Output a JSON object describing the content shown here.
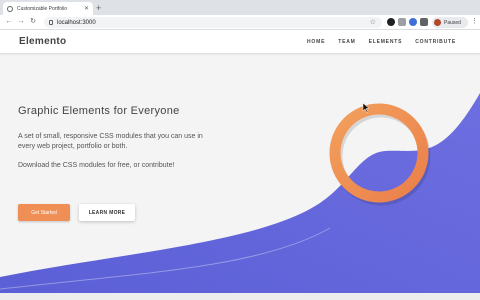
{
  "browser": {
    "tab_title": "Customizable Portfolio",
    "url": "localhost:3000",
    "profile_status": "Paused"
  },
  "site": {
    "brand": "Elemento",
    "nav": [
      "HOME",
      "TEAM",
      "ELEMENTS",
      "CONTRIBUTE"
    ]
  },
  "hero": {
    "title": "Graphic Elements for Everyone",
    "paragraph1": "A set of small, responsive CSS modules that you can use in every web project, portfolio or both.",
    "paragraph2": "Download the CSS modules for free, or contribute!",
    "primary_button": "Get Started",
    "secondary_button": "LEARN MORE"
  },
  "colors": {
    "accent": "#ef8f55",
    "wave": "#6a6ad8"
  },
  "icons": {
    "favicon": "globe-icon",
    "back": "arrow-left-icon",
    "forward": "arrow-right-icon",
    "reload": "reload-icon",
    "star": "star-icon",
    "menu": "kebab-menu-icon"
  }
}
